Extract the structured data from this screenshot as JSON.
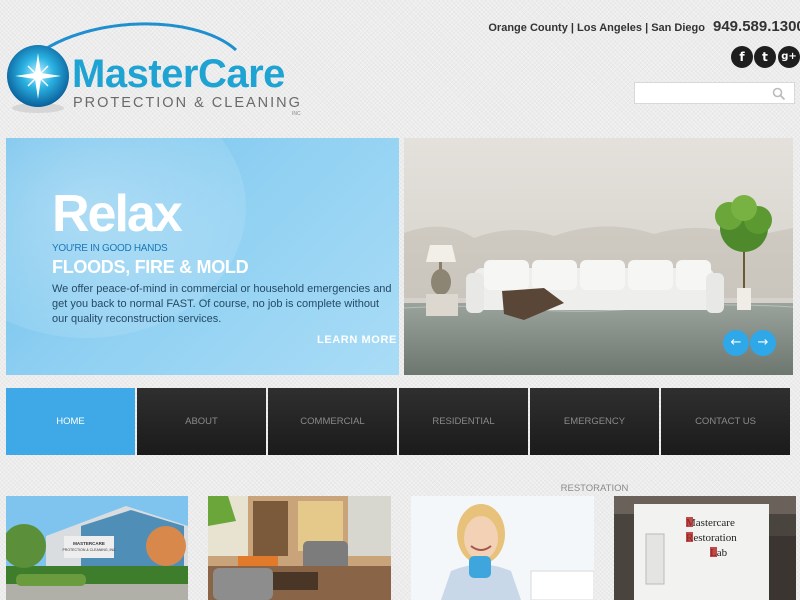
{
  "logo": {
    "brand": "MasterCare",
    "tagline": "PROTECTION & CLEANING",
    "suffix": "INC"
  },
  "header": {
    "locations": "Orange County | Los Angeles | San Diego",
    "phone": "949.589.1300",
    "social": [
      {
        "icon": "facebook-icon",
        "glyph": "f"
      },
      {
        "icon": "twitter-icon",
        "glyph": "t"
      },
      {
        "icon": "google-plus-icon",
        "glyph": "g+"
      }
    ],
    "search": {
      "placeholder": "",
      "value": "",
      "icon": "search-icon"
    }
  },
  "hero": {
    "title": "Relax",
    "kicker": "YOU'RE IN GOOD HANDS",
    "headline": "FLOODS, FIRE & MOLD",
    "body": "We offer peace-of-mind in commercial or household emergencies and get you back to normal FAST. Of course, no job is complete without our quality reconstruction services.",
    "cta": "LEARN MORE",
    "arrows": {
      "prev": "←",
      "next": "→"
    }
  },
  "nav": {
    "active_index": 0,
    "items": [
      "HOME",
      "ABOUT",
      "COMMERCIAL",
      "RESIDENTIAL",
      "EMERGENCY RESTORATION",
      "CONTACT US"
    ]
  },
  "tiles": {
    "building_sign": "MASTERCARE PROTECTION & CLEANING, INC",
    "lab_sign": [
      "Mastercare",
      "Restoration",
      "Lab"
    ]
  },
  "colors": {
    "brand_blue": "#1ea3d3",
    "nav_active": "#3fa8e6",
    "nav_bg": "#242424",
    "hero_blue": "#8fd0f2"
  }
}
